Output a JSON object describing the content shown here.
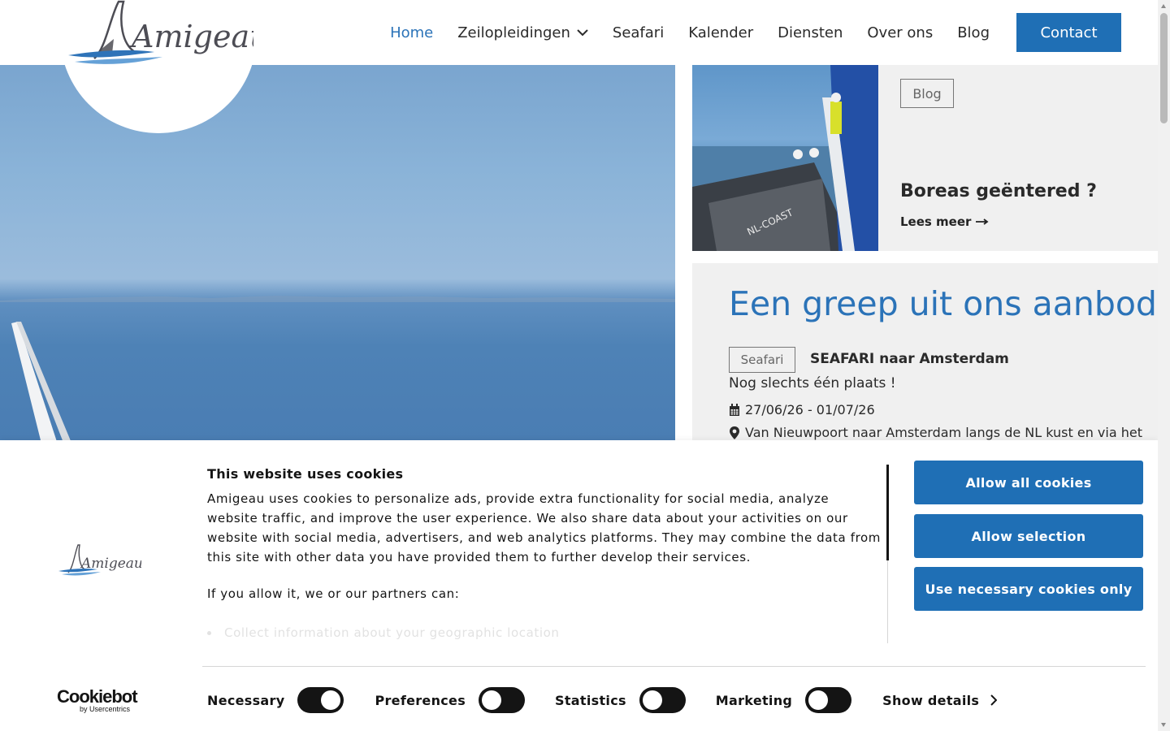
{
  "header": {
    "logo_text": "Amigeau",
    "nav": [
      {
        "label": "Home",
        "active": true
      },
      {
        "label": "Zeilopleidingen",
        "has_dropdown": true
      },
      {
        "label": "Seafari"
      },
      {
        "label": "Kalender"
      },
      {
        "label": "Diensten"
      },
      {
        "label": "Over ons"
      },
      {
        "label": "Blog"
      }
    ],
    "contact_label": "Contact"
  },
  "blog_card": {
    "tag": "Blog",
    "title": "Boreas geëntered ?",
    "read_more": "Lees meer",
    "image_caption_text": "NL-COAST"
  },
  "offer": {
    "title": "Een greep uit ons aanbod…",
    "item": {
      "tag": "Seafari",
      "name": "SEAFARI naar Amsterdam",
      "subtitle": "Nog slechts één plaats !",
      "date": "27/06/26 - 01/07/26",
      "location": "Van Nieuwpoort naar Amsterdam langs de NL kust en via het"
    }
  },
  "cookie_banner": {
    "logo_text": "Amigeau",
    "title": "This website uses cookies",
    "body": "Amigeau uses cookies to personalize ads, provide extra functionality for social media, analyze website traffic, and improve the user experience. We also share data about your activities on our website with social media, advertisers, and web analytics platforms. They may combine the data from this site with other data you have provided them to further develop their services.",
    "partners_intro": "If you allow it, we or our partners can:",
    "partners_list_first": "Collect information about your geographic location",
    "buttons": {
      "allow_all": "Allow all cookies",
      "allow_selection": "Allow selection",
      "necessary_only": "Use necessary cookies only"
    },
    "toggles": [
      {
        "label": "Necessary",
        "on": true
      },
      {
        "label": "Preferences",
        "on": false
      },
      {
        "label": "Statistics",
        "on": false
      },
      {
        "label": "Marketing",
        "on": false
      }
    ],
    "show_details": "Show details",
    "provider_logo_main": "Cookiebot",
    "provider_logo_sub": "by Usercentrics"
  },
  "colors": {
    "brand_blue": "#1f6fb5",
    "link_blue": "#2b73b8",
    "text_dark": "#2a2a2a",
    "card_bg": "#f0f0f0"
  }
}
